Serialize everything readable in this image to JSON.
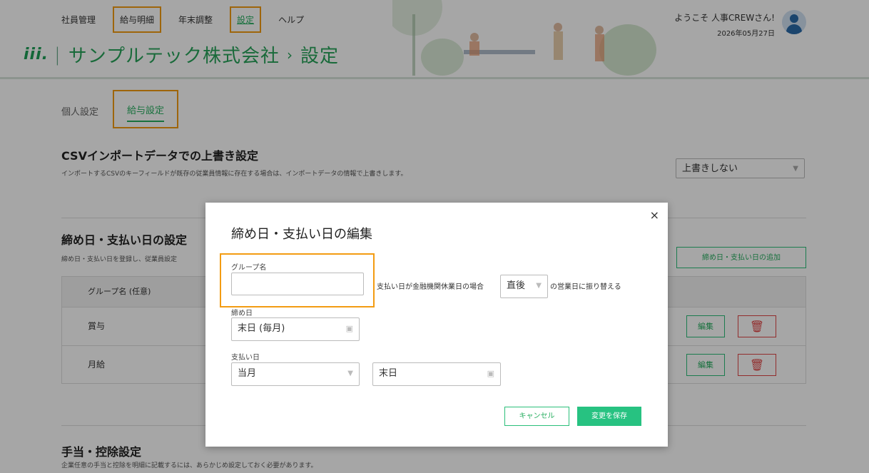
{
  "header": {
    "nav": [
      "社員管理",
      "給与明細",
      "年末調整",
      "設定",
      "ヘルプ"
    ],
    "logo_text": "iii.",
    "company": "サンプルテック株式会社",
    "breadcrumb_sep": "›",
    "page": "設定",
    "welcome": "ようこそ 人事CREWさん!",
    "date": "2026年05月27日"
  },
  "subtabs": [
    "個人設定",
    "給与設定"
  ],
  "csv": {
    "title": "CSVインポートデータでの上書き設定",
    "desc": "インポートするCSVのキーフィールドが既存の従業員情報に存在する場合は、インポートデータの情報で上書きします。",
    "select_value": "上書きしない"
  },
  "closing": {
    "title": "締め日・支払い日の設定",
    "desc": "締め日・支払い日を登録し、従業員設定",
    "add_button": "締め日・支払い日の追加",
    "column_header": "グループ名 (任意)",
    "rows": [
      "賞与",
      "月給"
    ],
    "edit_label": "編集",
    "delete_icon": "trash-icon"
  },
  "allowance": {
    "title": "手当・控除設定",
    "desc": "企業任意の手当と控除を明細に記載するには、あらかじめ設定しておく必要があります。"
  },
  "modal": {
    "title": "締め日・支払い日の編集",
    "close": "×",
    "group_label": "グループ名",
    "group_value": "",
    "holiday_text_before": "支払い日が金融機関休業日の場合",
    "holiday_select": "直後",
    "holiday_text_after": "の営業日に振り替える",
    "closing_label": "締め日",
    "closing_value": "末日 (毎月)",
    "payment_label": "支払い日",
    "payment_month": "当月",
    "payment_day": "末日",
    "cancel": "キャンセル",
    "save": "変更を保存"
  },
  "colors": {
    "accent": "#27ae60",
    "highlight": "#f39c12",
    "danger": "#e04545"
  }
}
